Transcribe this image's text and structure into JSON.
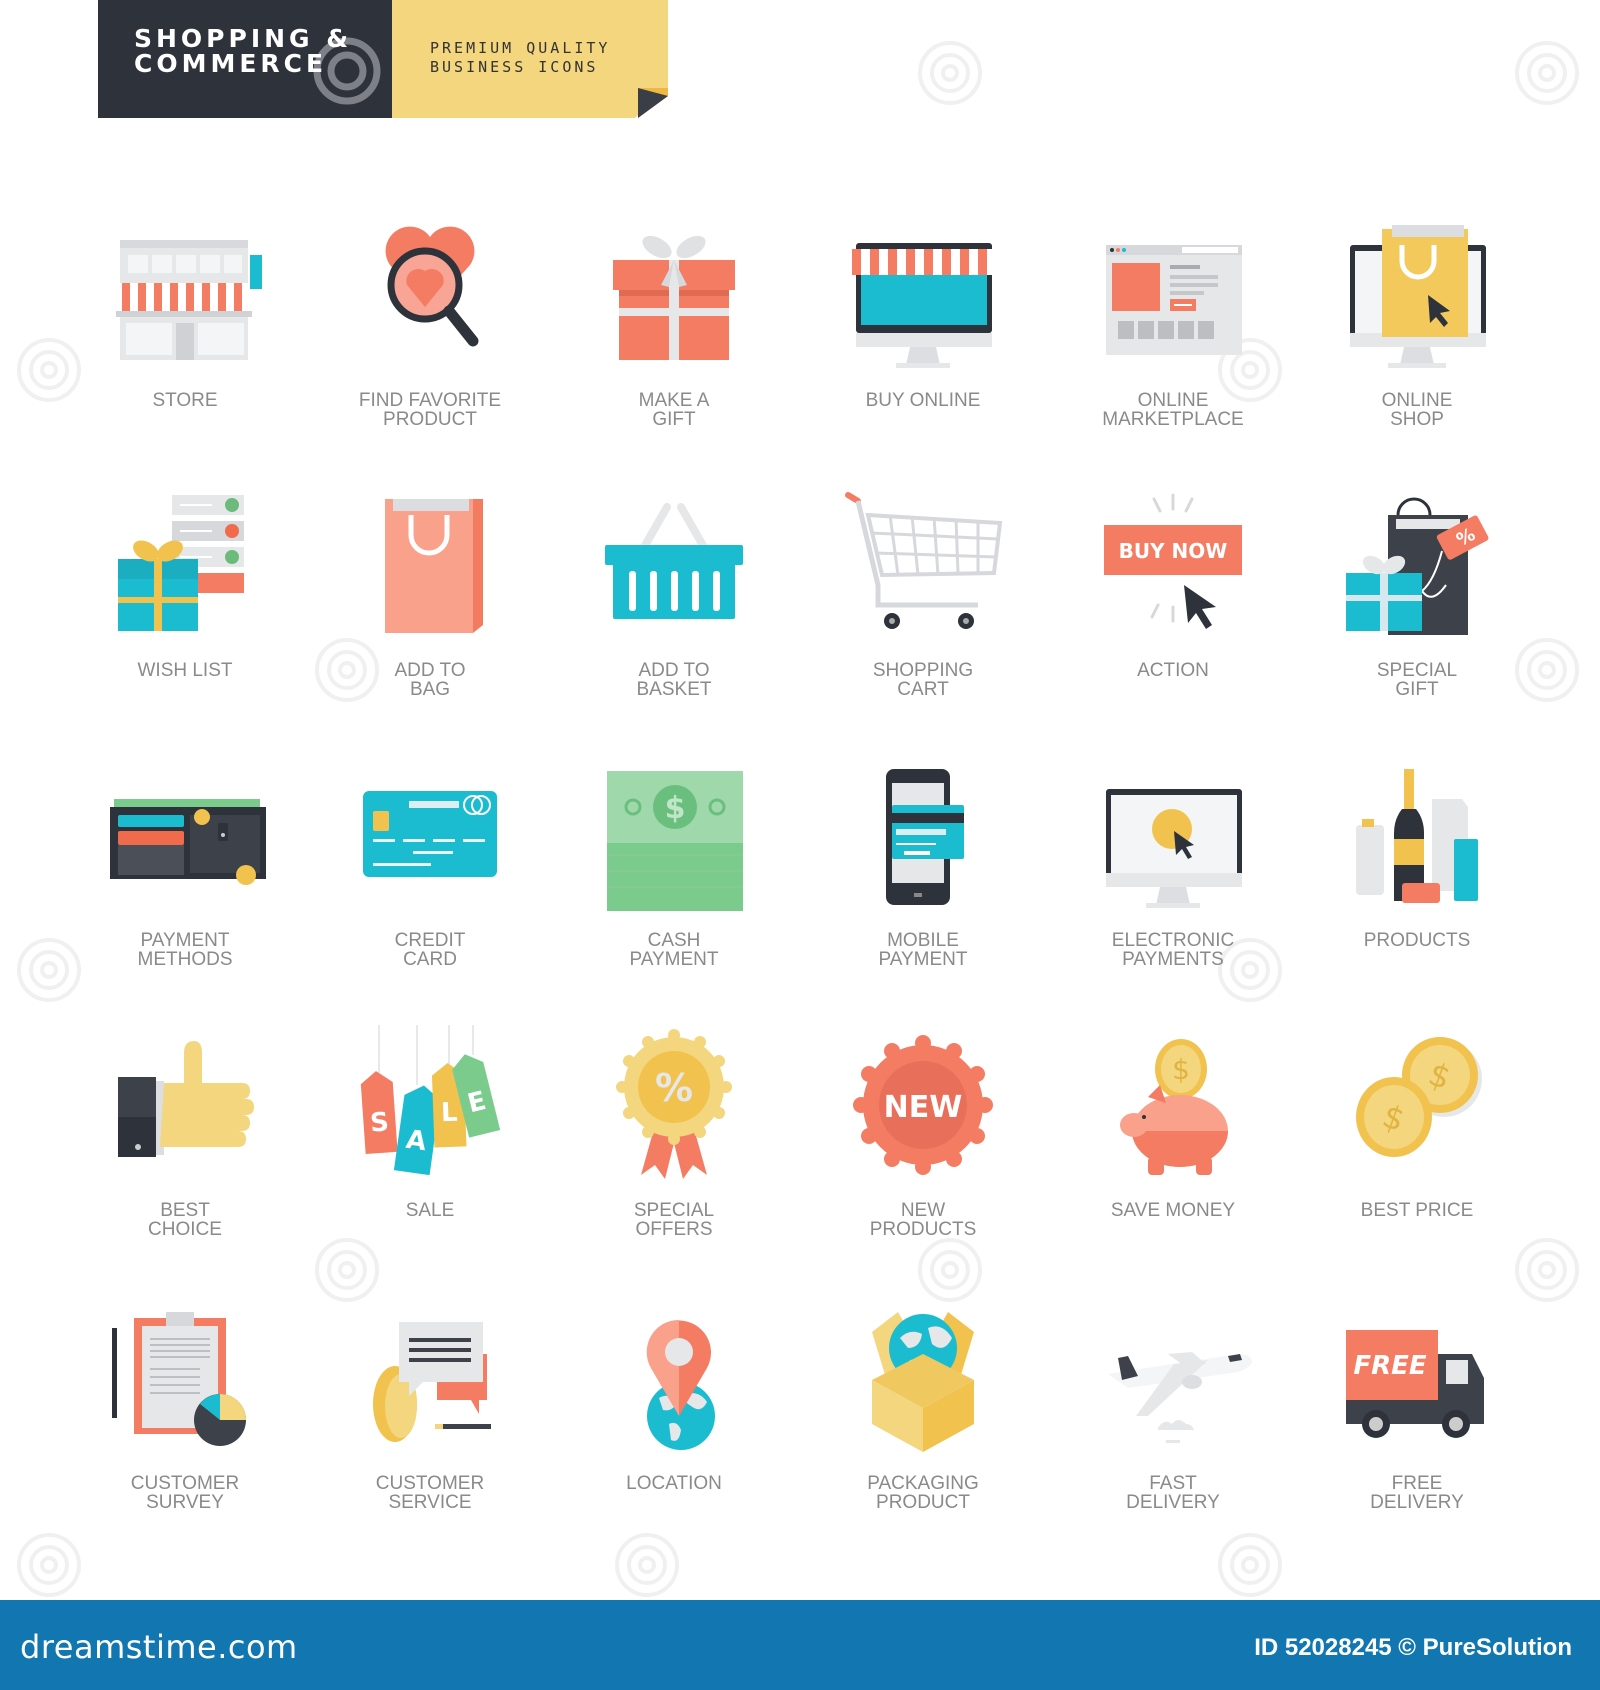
{
  "header": {
    "title_line1": "SHOPPING &",
    "title_line2": "COMMERCE",
    "subtitle_line1": "PREMIUM QUALITY",
    "subtitle_line2": "BUSINESS ICONS"
  },
  "colors": {
    "dark": "#2e323b",
    "yellow": "#f3d67d",
    "coral": "#f47c63",
    "cyan": "#1cbcd0",
    "gold": "#f1c24e",
    "green": "#7acb8c",
    "light_gray": "#e6e7e9",
    "label_gray": "#8a8a8a",
    "footer_blue": "#1276b0"
  },
  "icons": [
    {
      "id": "store",
      "label": "STORE"
    },
    {
      "id": "find-favorite-product",
      "label": "FIND FAVORITE\nPRODUCT"
    },
    {
      "id": "make-a-gift",
      "label": "MAKE A\nGIFT"
    },
    {
      "id": "buy-online",
      "label": "BUY ONLINE"
    },
    {
      "id": "online-marketplace",
      "label": "ONLINE\nMARKETPLACE"
    },
    {
      "id": "online-shop",
      "label": "ONLINE\nSHOP"
    },
    {
      "id": "wish-list",
      "label": "WISH LIST"
    },
    {
      "id": "add-to-bag",
      "label": "ADD TO\nBAG"
    },
    {
      "id": "add-to-basket",
      "label": "ADD TO\nBASKET"
    },
    {
      "id": "shopping-cart",
      "label": "SHOPPING\nCART"
    },
    {
      "id": "action",
      "label": "ACTION",
      "button_text": "BUY NOW"
    },
    {
      "id": "special-gift",
      "label": "SPECIAL\nGIFT",
      "tag_text": "%"
    },
    {
      "id": "payment-methods",
      "label": "PAYMENT\nMETHODS"
    },
    {
      "id": "credit-card",
      "label": "CREDIT\nCARD"
    },
    {
      "id": "cash-payment",
      "label": "CASH\nPAYMENT",
      "symbol": "$"
    },
    {
      "id": "mobile-payment",
      "label": "MOBILE\nPAYMENT"
    },
    {
      "id": "electronic-payments",
      "label": "ELECTRONIC\nPAYMENTS"
    },
    {
      "id": "products",
      "label": "PRODUCTS"
    },
    {
      "id": "best-choice",
      "label": "BEST\nCHOICE"
    },
    {
      "id": "sale",
      "label": "SALE",
      "tag_letters": [
        "S",
        "A",
        "L",
        "E"
      ]
    },
    {
      "id": "special-offers",
      "label": "SPECIAL\nOFFERS",
      "badge_text": "%"
    },
    {
      "id": "new-products",
      "label": "NEW\nPRODUCTS",
      "badge_text": "NEW"
    },
    {
      "id": "save-money",
      "label": "SAVE MONEY",
      "symbol": "$"
    },
    {
      "id": "best-price",
      "label": "BEST PRICE",
      "symbol": "$"
    },
    {
      "id": "customer-survey",
      "label": "CUSTOMER\nSURVEY"
    },
    {
      "id": "customer-service",
      "label": "CUSTOMER\nSERVICE"
    },
    {
      "id": "location",
      "label": "LOCATION"
    },
    {
      "id": "packaging-product",
      "label": "PACKAGING\nPRODUCT"
    },
    {
      "id": "fast-delivery",
      "label": "FAST\nDELIVERY"
    },
    {
      "id": "free-delivery",
      "label": "FREE\nDELIVERY",
      "truck_text": "FREE"
    }
  ],
  "footer": {
    "logo": "dreamstime.com",
    "id_text": "ID 52028245 © PureSolution"
  }
}
